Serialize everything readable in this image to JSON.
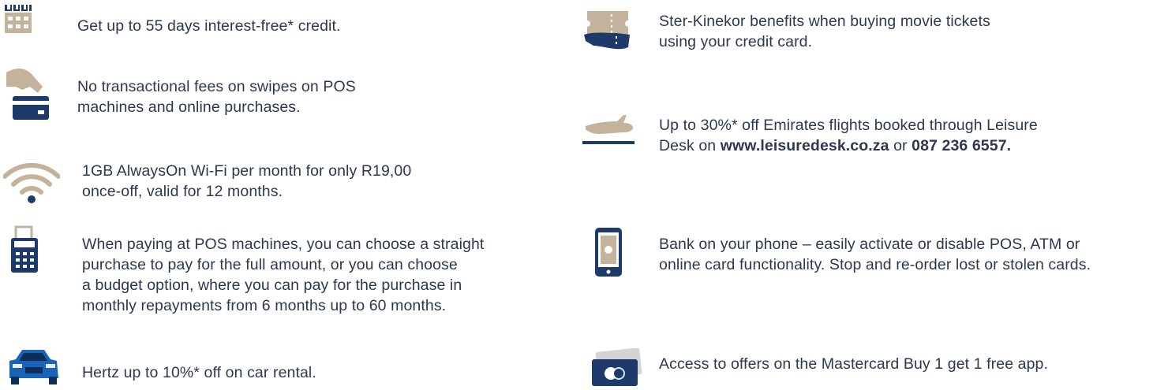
{
  "colors": {
    "navy": "#1e3a6b",
    "gold": "#c3b39a",
    "blue": "#1a64b7",
    "text": "#2c3850"
  },
  "left": [
    {
      "icon": "calendar-icon",
      "lines": [
        "Get up to 55 days interest-free* credit."
      ]
    },
    {
      "icon": "card-tap-icon",
      "lines": [
        "No transactional fees on swipes on POS",
        "machines and online purchases."
      ]
    },
    {
      "icon": "wifi-icon",
      "lines": [
        "1GB AlwaysOn Wi-Fi per month for only R19,00",
        "once-off, valid for 12 months."
      ]
    },
    {
      "icon": "pos-terminal-icon",
      "lines": [
        "When paying at POS machines, you can choose a straight",
        "purchase to pay for the full amount, or you can choose",
        "a budget option, where you can pay for the purchase in",
        "monthly repayments from 6 months up to 60 months."
      ]
    },
    {
      "icon": "car-icon",
      "lines": [
        "Hertz up to 10%* off on car rental."
      ]
    }
  ],
  "right": [
    {
      "icon": "movie-ticket-icon",
      "lines": [
        "Ster-Kinekor benefits when buying movie tickets",
        "using your credit card."
      ]
    },
    {
      "icon": "airplane-icon",
      "line1": "Up to 30%* off Emirates flights booked through Leisure",
      "line2_prefix": "Desk on ",
      "link": "www.leisuredesk.co.za",
      "line2_mid": " or ",
      "phone": "087 236 6557."
    },
    {
      "icon": "phone-icon",
      "lines": [
        "Bank on your phone – easily activate or disable POS, ATM or",
        "online card functionality. Stop and re-order lost or stolen cards."
      ]
    },
    {
      "icon": "mastercard-icon",
      "lines": [
        "Access to offers on the Mastercard Buy 1 get 1 free app."
      ]
    }
  ]
}
